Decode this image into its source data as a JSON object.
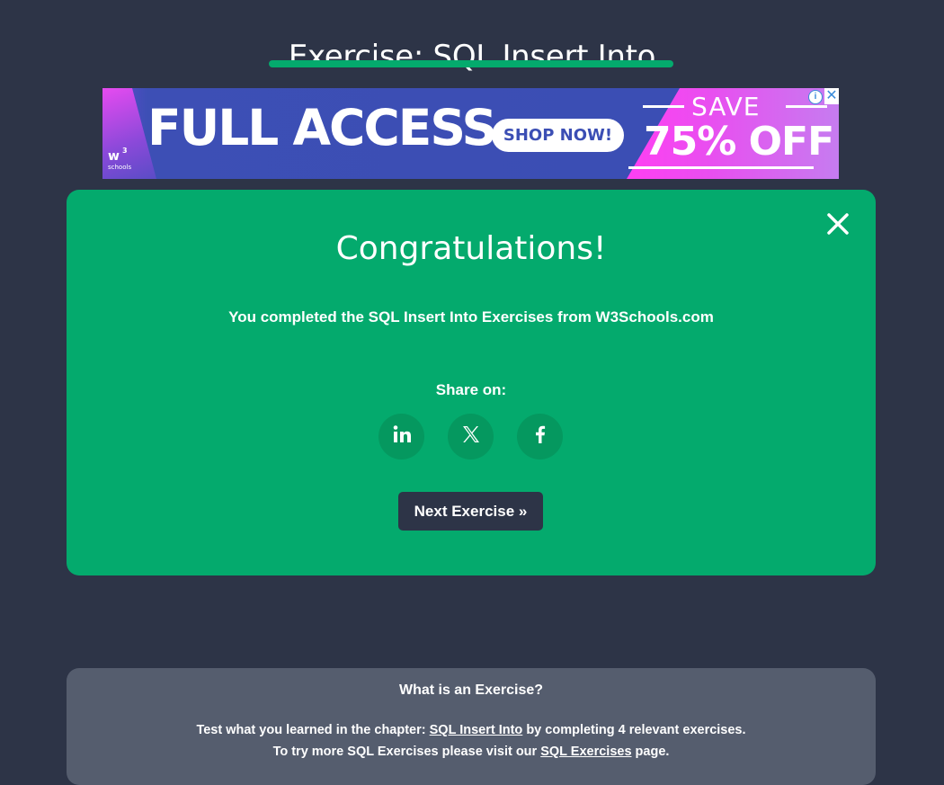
{
  "page": {
    "title": "Exercise: SQL Insert Into",
    "accent_color": "#04aa6d",
    "background_color": "#2d3447"
  },
  "ad": {
    "headline": "FULL ACCESS",
    "cta_label": "SHOP NOW!",
    "save_label": "SAVE",
    "discount_label": "75% OFF",
    "logo_text": "w",
    "logo_superscript": "3",
    "logo_subtext": "schools",
    "info_icon": "info-icon",
    "close_icon": "close-icon"
  },
  "congrats": {
    "title": "Congratulations!",
    "message": "You completed the SQL Insert Into Exercises from W3Schools.com",
    "share_label": "Share on:",
    "share_buttons": [
      {
        "icon": "linkedin-icon",
        "glyph": "in"
      },
      {
        "icon": "x-twitter-icon",
        "glyph": "𝕏"
      },
      {
        "icon": "facebook-icon",
        "glyph": "f"
      }
    ],
    "next_button_label": "Next Exercise »",
    "close_icon": "close-icon"
  },
  "info": {
    "title": "What is an Exercise?",
    "line1_prefix": "Test what you learned in the chapter: ",
    "line1_link": "SQL Insert Into",
    "line1_suffix": " by completing 4 relevant exercises.",
    "line2_prefix": "To try more SQL Exercises please visit our ",
    "line2_link": "SQL Exercises",
    "line2_suffix": " page."
  }
}
